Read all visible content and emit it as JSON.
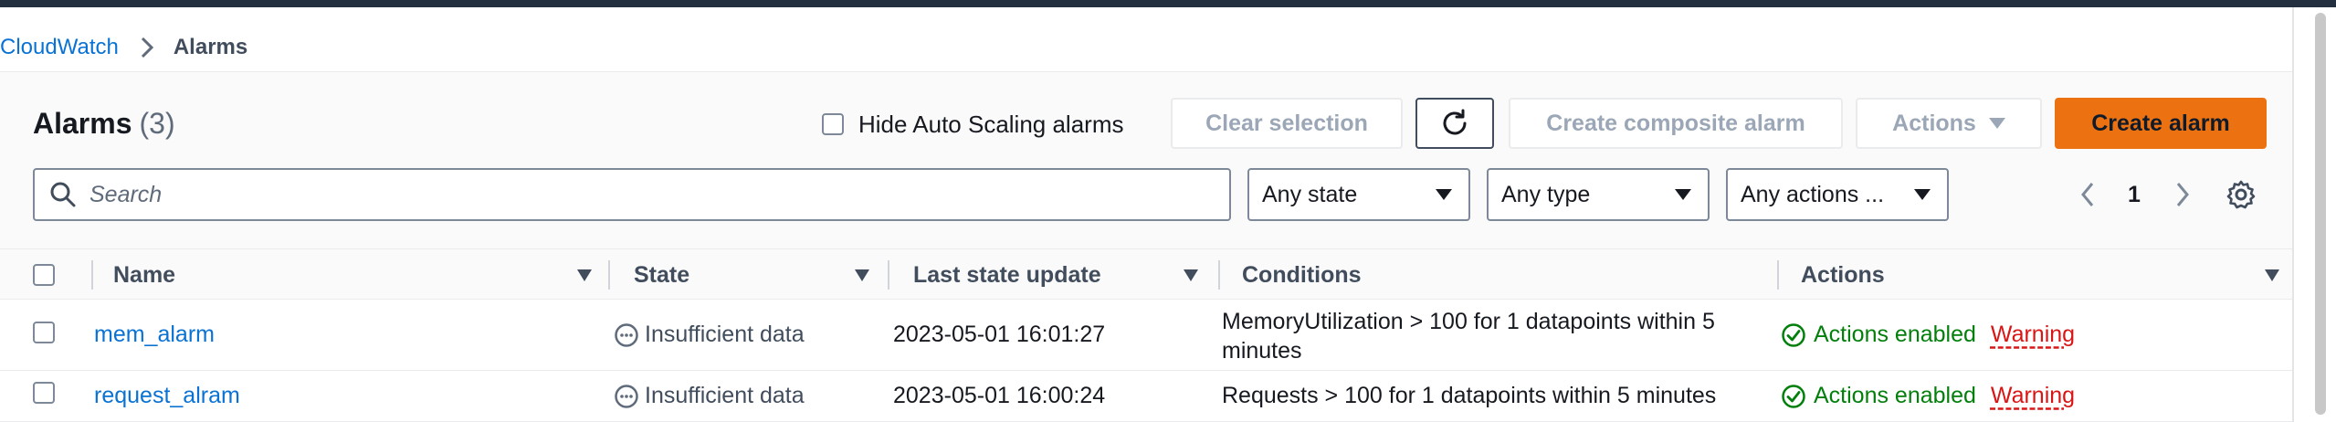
{
  "breadcrumb": {
    "root": "CloudWatch",
    "current": "Alarms"
  },
  "header": {
    "title": "Alarms",
    "count": "(3)"
  },
  "toolbar": {
    "hide_autoscaling_label": "Hide Auto Scaling alarms",
    "clear_selection": "Clear selection",
    "create_composite": "Create composite alarm",
    "actions": "Actions",
    "create_alarm": "Create alarm"
  },
  "filters": {
    "search_placeholder": "Search",
    "state": "Any state",
    "type": "Any type",
    "actions": "Any actions ..."
  },
  "pagination": {
    "current_page": "1"
  },
  "table": {
    "columns": [
      "Name",
      "State",
      "Last state update",
      "Conditions",
      "Actions"
    ],
    "rows": [
      {
        "name": "mem_alarm",
        "state": "Insufficient data",
        "last_update": "2023-05-01 16:01:27",
        "conditions_line1": "MemoryUtilization > 100 for 1 datapoints within 5",
        "conditions_line2": "minutes",
        "actions_status": "Actions enabled",
        "severity": "Warning"
      },
      {
        "name": "request_alram",
        "state": "Insufficient data",
        "last_update": "2023-05-01 16:00:24",
        "conditions_line1": "Requests > 100 for 1 datapoints within 5 minutes",
        "conditions_line2": "",
        "actions_status": "Actions enabled",
        "severity": "Warning"
      }
    ]
  },
  "colors": {
    "primary": "#ec7211",
    "link": "#0972d3",
    "success": "#037f0c",
    "warning": "#d91515",
    "topbar": "#232f3e"
  },
  "icons": {
    "breadcrumb_separator": "chevron-right-icon",
    "refresh": "refresh-icon",
    "search": "search-icon",
    "prev": "chevron-left-icon",
    "next": "chevron-right-icon",
    "settings": "gear-icon",
    "state": "status-pending-icon",
    "actions": "status-positive-icon"
  }
}
